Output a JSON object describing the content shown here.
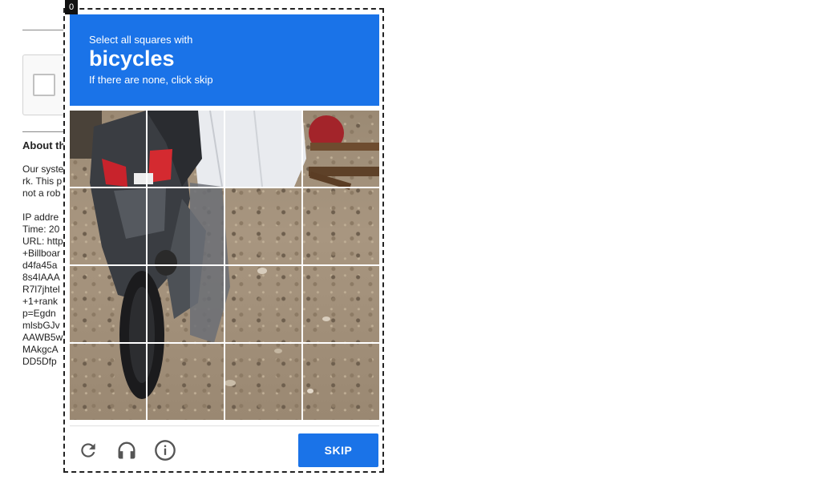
{
  "badge": "0",
  "challenge": {
    "instruction": "Select all squares with",
    "target": "bicycles",
    "hint": "If there are none, click skip",
    "tiles_count": 16
  },
  "background": {
    "heading": "About th",
    "paragraph": [
      "Our syste",
      "rk. This p",
      "not a rob"
    ],
    "details": [
      "IP addre",
      "Time: 20",
      "URL: http",
      "+Billboar",
      "d4fa45a",
      "8s4IAAA",
      "R7l7jhtel",
      "+1+rank",
      "p=Egdn",
      "mlsbGJv",
      "AAWB5w",
      "MAkgcA",
      "DD5Dfp"
    ]
  },
  "footer": {
    "reload_icon": "reload-icon",
    "audio_icon": "headphones-icon",
    "info_icon": "info-icon",
    "skip_label": "SKIP"
  },
  "colors": {
    "accent": "#1a73e8"
  }
}
